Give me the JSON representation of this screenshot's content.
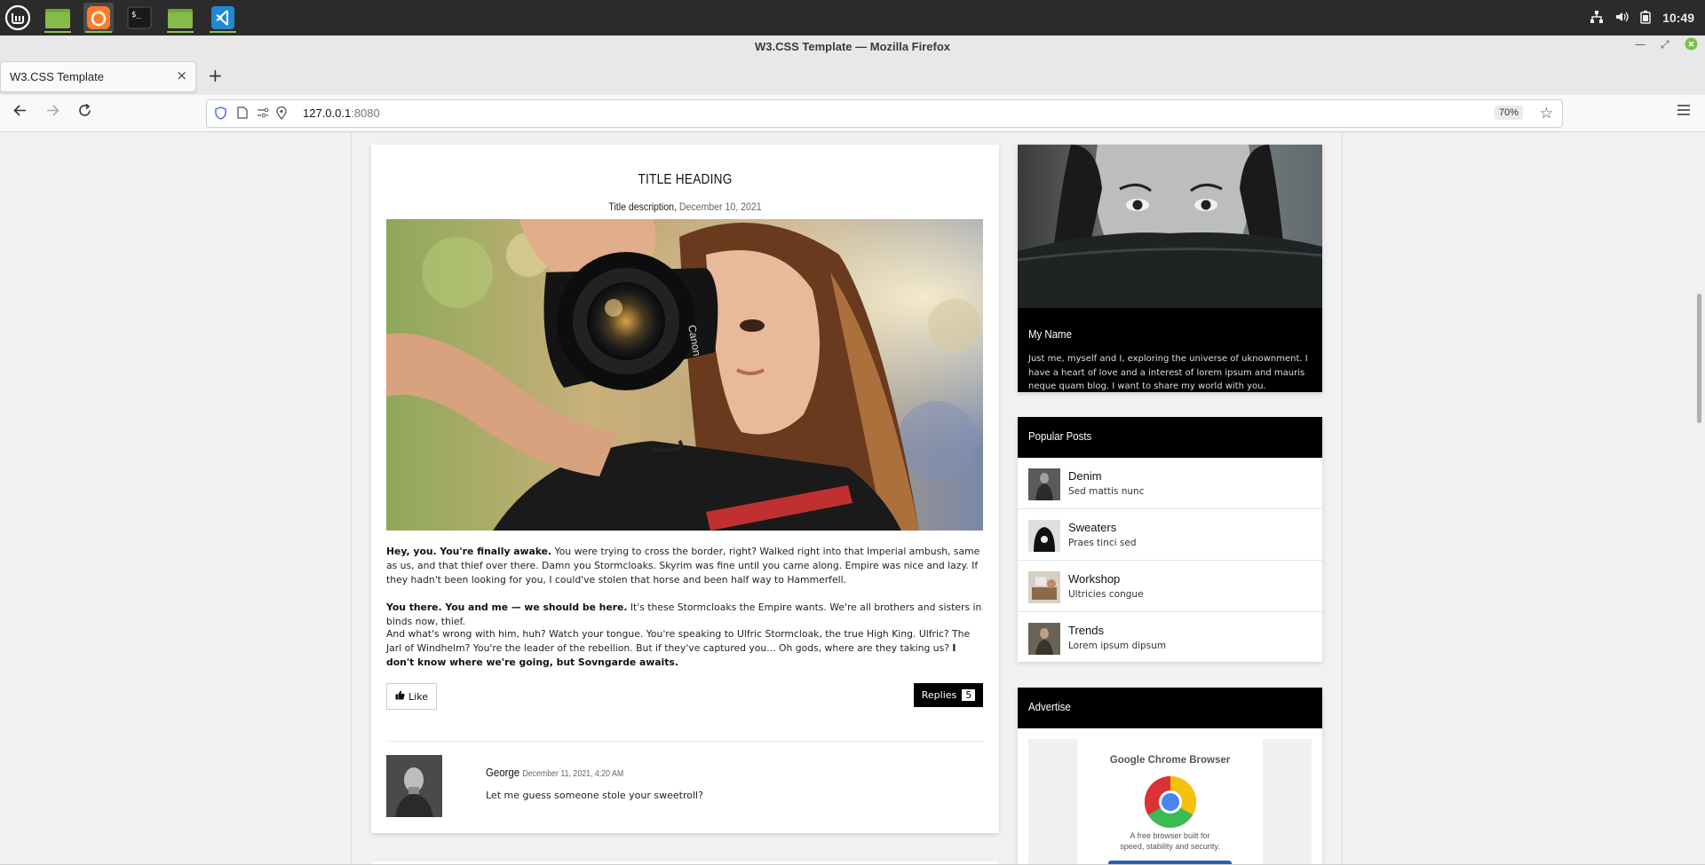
{
  "os": {
    "clock": "10:49",
    "apps": [
      "mint-menu",
      "files",
      "firefox",
      "terminal",
      "files",
      "vscode"
    ]
  },
  "browser": {
    "window_title": "W3.CSS Template — Mozilla Firefox",
    "tab_title": "W3.CSS Template",
    "url_host": "127.0.0.1",
    "url_port": ":8080",
    "zoom": "70%"
  },
  "post": {
    "title": "TITLE HEADING",
    "description": "Title description,",
    "date": "December 10, 2021",
    "p1_bold": "Hey, you. You're finally awake.",
    "p1_rest": " You were trying to cross the border, right? Walked right into that Imperial ambush, same as us, and that thief over there. Damn you Stormcloaks. Skyrim was fine until you came along. Empire was nice and lazy. If they hadn't been looking for you, I could've stolen that horse and been half way to Hammerfell.",
    "p2_bold": "You there. You and me — we should be here.",
    "p2_rest": " It's these Stormcloaks the Empire wants. We're all brothers and sisters in binds now, thief.",
    "p3_rest": "And what's wrong with him, huh? Watch your tongue. You're speaking to Ulfric Stormcloak, the true High King. Ulfric? The Jarl of Windhelm? You're the leader of the rebellion. But if they've captured you... Oh gods, where are they taking us? ",
    "p3_bold": "I don't know where we're going, but Sovngarde awaits.",
    "like_label": "Like",
    "replies_label": "Replies",
    "replies_count": "5",
    "comment": {
      "author": "George",
      "date": "December 11, 2021, 4:20 AM",
      "text": "Let me guess someone stole your sweetroll?"
    }
  },
  "profile": {
    "name": "My Name",
    "bio": "Just me, myself and I, exploring the universe of uknownment. I have a heart of love and a interest of lorem ipsum and mauris neque quam blog. I want to share my world with you."
  },
  "popular": {
    "heading": "Popular Posts",
    "items": [
      {
        "title": "Denim",
        "subtitle": "Sed mattis nunc"
      },
      {
        "title": "Sweaters",
        "subtitle": "Praes tinci sed"
      },
      {
        "title": "Workshop",
        "subtitle": "Ultricies congue"
      },
      {
        "title": "Trends",
        "subtitle": "Lorem ipsum dipsum"
      }
    ]
  },
  "advertise": {
    "heading": "Advertise",
    "ad_title": "Google Chrome Browser",
    "ad_tagline_1": "A free browser built for",
    "ad_tagline_2": "speed, stability and security."
  }
}
